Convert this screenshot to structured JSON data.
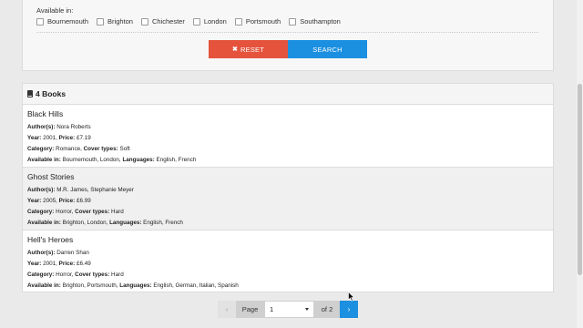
{
  "filters": {
    "available_label": "Available in:",
    "cities": [
      "Bournemouth",
      "Brighton",
      "Chichester",
      "London",
      "Portsmouth",
      "Southampton"
    ],
    "reset_label": "RESET",
    "reset_icon": "x-icon",
    "search_label": "SEARCH",
    "colors": {
      "reset": "#e5533d",
      "search": "#1b8fe0"
    }
  },
  "results": {
    "header": "4 Books",
    "header_icon": "book-icon",
    "labels": {
      "authors": "Author(s):",
      "year": "Year:",
      "price": "Price:",
      "category": "Category:",
      "cover": "Cover types:",
      "available": "Available in:",
      "languages": "Languages:"
    },
    "books": [
      {
        "title": "Black Hills",
        "authors": "Nora Roberts",
        "year": "2001,",
        "price": "£7.19",
        "category": "Romance,",
        "cover": "Soft",
        "available": "Bournemouth, London,",
        "languages": "English, French"
      },
      {
        "title": "Ghost Stories",
        "authors": "M.R. James, Stephanie Meyer",
        "year": "2005,",
        "price": "£6.99",
        "category": "Horror,",
        "cover": "Hard",
        "available": "Brighton, London,",
        "languages": "English, French"
      },
      {
        "title": "Hell's Heroes",
        "authors": "Darren Shan",
        "year": "2001,",
        "price": "£6.49",
        "category": "Horror,",
        "cover": "Hard",
        "available": "Brighton, Portsmouth,",
        "languages": "English, German, Italian, Spanish"
      }
    ]
  },
  "pagination": {
    "prev": "‹",
    "page_label": "Page",
    "current_page": "1",
    "of_label": "of 2",
    "next": "›"
  }
}
